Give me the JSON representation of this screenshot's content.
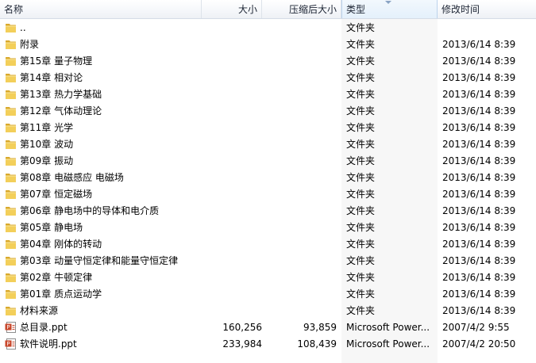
{
  "columns": {
    "name": "名称",
    "size": "大小",
    "compressed": "压缩后大小",
    "type": "类型",
    "modified": "修改时间"
  },
  "rows": [
    {
      "name": "..",
      "size": "",
      "compressed": "",
      "type": "文件夹",
      "modified": "",
      "icon": "folder-icon"
    },
    {
      "name": "附录",
      "size": "",
      "compressed": "",
      "type": "文件夹",
      "modified": "2013/6/14 8:39",
      "icon": "folder-icon"
    },
    {
      "name": "第15章 量子物理",
      "size": "",
      "compressed": "",
      "type": "文件夹",
      "modified": "2013/6/14 8:39",
      "icon": "folder-icon"
    },
    {
      "name": "第14章 相对论",
      "size": "",
      "compressed": "",
      "type": "文件夹",
      "modified": "2013/6/14 8:39",
      "icon": "folder-icon"
    },
    {
      "name": "第13章 热力学基础",
      "size": "",
      "compressed": "",
      "type": "文件夹",
      "modified": "2013/6/14 8:39",
      "icon": "folder-icon"
    },
    {
      "name": "第12章 气体动理论",
      "size": "",
      "compressed": "",
      "type": "文件夹",
      "modified": "2013/6/14 8:39",
      "icon": "folder-icon"
    },
    {
      "name": "第11章  光学",
      "size": "",
      "compressed": "",
      "type": "文件夹",
      "modified": "2013/6/14 8:39",
      "icon": "folder-icon"
    },
    {
      "name": "第10章 波动",
      "size": "",
      "compressed": "",
      "type": "文件夹",
      "modified": "2013/6/14 8:39",
      "icon": "folder-icon"
    },
    {
      "name": "第09章 振动",
      "size": "",
      "compressed": "",
      "type": "文件夹",
      "modified": "2013/6/14 8:39",
      "icon": "folder-icon"
    },
    {
      "name": "第08章 电磁感应  电磁场",
      "size": "",
      "compressed": "",
      "type": "文件夹",
      "modified": "2013/6/14 8:39",
      "icon": "folder-icon"
    },
    {
      "name": "第07章 恒定磁场",
      "size": "",
      "compressed": "",
      "type": "文件夹",
      "modified": "2013/6/14 8:39",
      "icon": "folder-icon"
    },
    {
      "name": "第06章 静电场中的导体和电介质",
      "size": "",
      "compressed": "",
      "type": "文件夹",
      "modified": "2013/6/14 8:39",
      "icon": "folder-icon"
    },
    {
      "name": "第05章 静电场",
      "size": "",
      "compressed": "",
      "type": "文件夹",
      "modified": "2013/6/14 8:39",
      "icon": "folder-icon"
    },
    {
      "name": "第04章 刚体的转动",
      "size": "",
      "compressed": "",
      "type": "文件夹",
      "modified": "2013/6/14 8:39",
      "icon": "folder-icon"
    },
    {
      "name": "第03章 动量守恒定律和能量守恒定律",
      "size": "",
      "compressed": "",
      "type": "文件夹",
      "modified": "2013/6/14 8:39",
      "icon": "folder-icon"
    },
    {
      "name": "第02章 牛顿定律",
      "size": "",
      "compressed": "",
      "type": "文件夹",
      "modified": "2013/6/14 8:39",
      "icon": "folder-icon"
    },
    {
      "name": "第01章 质点运动学",
      "size": "",
      "compressed": "",
      "type": "文件夹",
      "modified": "2013/6/14 8:39",
      "icon": "folder-icon"
    },
    {
      "name": "材料来源",
      "size": "",
      "compressed": "",
      "type": "文件夹",
      "modified": "2013/6/14 8:39",
      "icon": "folder-icon"
    },
    {
      "name": "总目录.ppt",
      "size": "160,256",
      "compressed": "93,859",
      "type": "Microsoft Power...",
      "modified": "2007/4/2 9:55",
      "icon": "powerpoint-icon"
    },
    {
      "name": "软件说明.ppt",
      "size": "233,984",
      "compressed": "108,439",
      "type": "Microsoft Power...",
      "modified": "2007/4/2 20:50",
      "icon": "powerpoint-icon"
    }
  ],
  "colors": {
    "folder": "#f3cf5a",
    "folder_dark": "#d9a92c",
    "ppt": "#c8472b",
    "sorted_column": "#f7f7f7"
  }
}
